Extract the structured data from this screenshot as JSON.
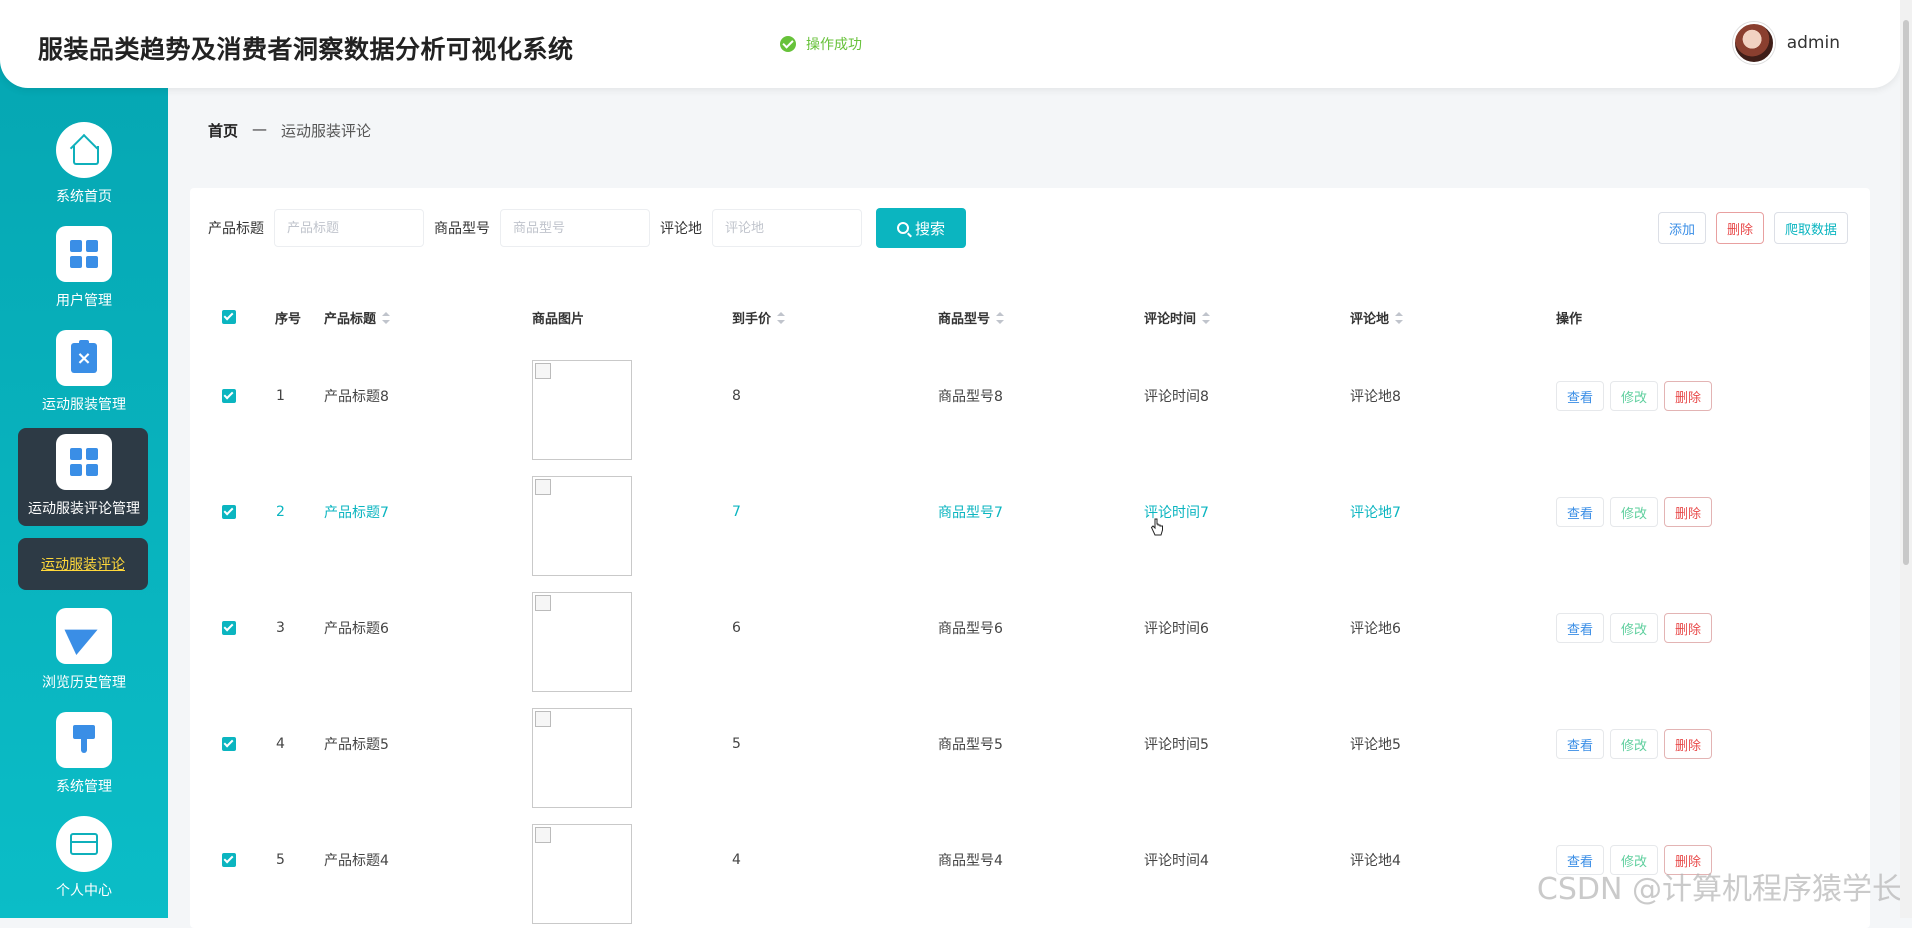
{
  "header": {
    "title": "服装品类趋势及消费者洞察数据分析可视化系统",
    "toast": "操作成功",
    "username": "admin"
  },
  "sidebar": {
    "items": [
      {
        "label": "系统首页",
        "icon": "home-icon"
      },
      {
        "label": "用户管理",
        "icon": "grid-icon"
      },
      {
        "label": "运动服装管理",
        "icon": "clipboard-icon"
      },
      {
        "label": "运动服装评论管理",
        "icon": "grid-icon"
      },
      {
        "label": "浏览历史管理",
        "icon": "paper-plane-icon"
      },
      {
        "label": "系统管理",
        "icon": "brush-icon"
      },
      {
        "label": "个人中心",
        "icon": "card-icon"
      }
    ],
    "sub_item": "运动服装评论"
  },
  "breadcrumb": {
    "home": "首页",
    "sep": "—",
    "current": "运动服装评论"
  },
  "search": {
    "f1_label": "产品标题",
    "f1_placeholder": "产品标题",
    "f2_label": "商品型号",
    "f2_placeholder": "商品型号",
    "f3_label": "评论地",
    "f3_placeholder": "评论地",
    "button": "搜索"
  },
  "toolbar": {
    "add": "添加",
    "delete": "删除",
    "crawl": "爬取数据"
  },
  "table": {
    "columns": [
      "序号",
      "产品标题",
      "商品图片",
      "到手价",
      "商品型号",
      "评论时间",
      "评论地",
      "操作"
    ],
    "rows": [
      {
        "idx": "1",
        "title": "产品标题8",
        "price": "8",
        "model": "商品型号8",
        "time": "评论时间8",
        "place": "评论地8"
      },
      {
        "idx": "2",
        "title": "产品标题7",
        "price": "7",
        "model": "商品型号7",
        "time": "评论时间7",
        "place": "评论地7"
      },
      {
        "idx": "3",
        "title": "产品标题6",
        "price": "6",
        "model": "商品型号6",
        "time": "评论时间6",
        "place": "评论地6"
      },
      {
        "idx": "4",
        "title": "产品标题5",
        "price": "5",
        "model": "商品型号5",
        "time": "评论时间5",
        "place": "评论地5"
      },
      {
        "idx": "5",
        "title": "产品标题4",
        "price": "4",
        "model": "商品型号4",
        "time": "评论时间4",
        "place": "评论地4"
      }
    ],
    "ops": {
      "view": "查看",
      "edit": "修改",
      "delete": "删除"
    }
  },
  "watermark": "CSDN @计算机程序猿学长",
  "colors": {
    "accent": "#0bb5c0",
    "sidebar_dark": "#2d3a45",
    "danger": "#e84a4a",
    "link": "#3a8ee6"
  }
}
